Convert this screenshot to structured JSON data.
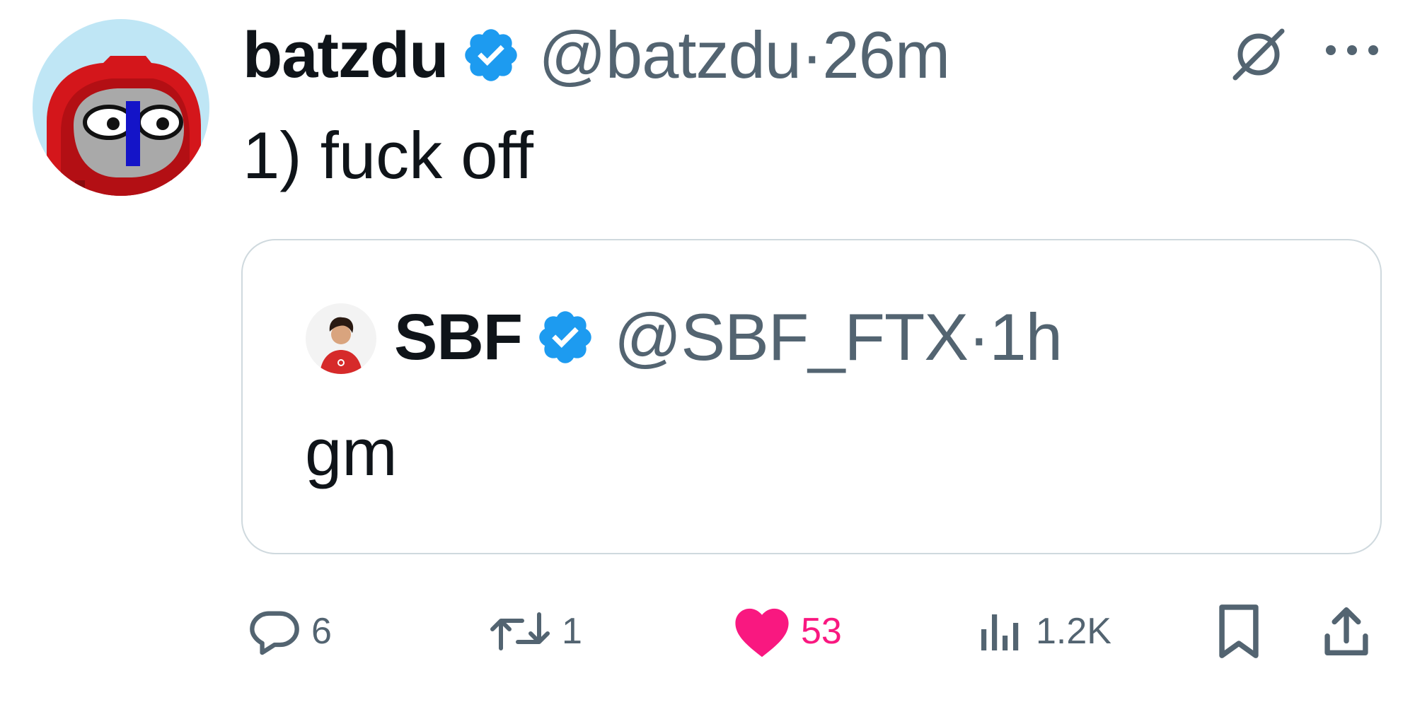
{
  "tweet": {
    "author_name": "batzdu",
    "author_handle": "@batzdu",
    "separator": "·",
    "time": "26m",
    "text": "1) fuck off",
    "verified_icon": "verified-badge-icon",
    "grok_icon": "grok-icon",
    "more_icon": "more-dots-icon"
  },
  "quote": {
    "author_name": "SBF",
    "author_handle": "@SBF_FTX",
    "separator": "·",
    "time": "1h",
    "text": "gm",
    "verified_icon": "verified-badge-icon"
  },
  "actions": {
    "replies": "6",
    "reposts": "1",
    "likes": "53",
    "views": "1.2K",
    "reply_icon": "reply-icon",
    "repost_icon": "repost-icon",
    "like_icon": "heart-icon",
    "views_icon": "views-bar-chart-icon",
    "bookmark_icon": "bookmark-icon",
    "share_icon": "share-icon"
  },
  "colors": {
    "text_primary": "#0f1419",
    "text_secondary": "#536471",
    "verified_blue": "#1d9bf0",
    "like_pink": "#f91880",
    "card_border": "#cfd9de",
    "avatar_bg": "#bfe6f5",
    "hood_red": "#d4161b"
  }
}
